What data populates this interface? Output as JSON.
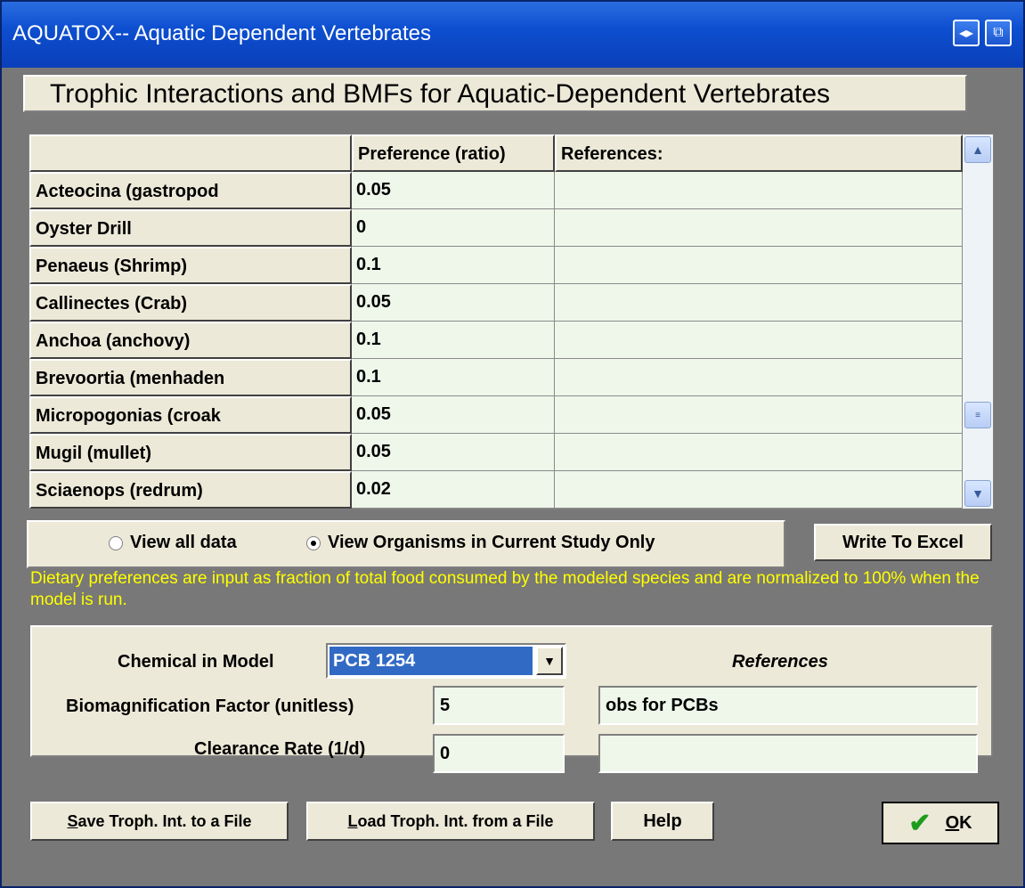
{
  "window": {
    "title": "AQUATOX-- Aquatic Dependent Vertebrates"
  },
  "header": {
    "title": "Trophic Interactions and BMFs for Aquatic-Dependent Vertebrates"
  },
  "grid": {
    "columns": [
      "",
      "Preference (ratio)",
      "References:"
    ],
    "rows": [
      {
        "name": "Acteocina (gastropod",
        "pref": "0.05",
        "ref": ""
      },
      {
        "name": "Oyster Drill",
        "pref": "0",
        "ref": ""
      },
      {
        "name": "Penaeus (Shrimp)",
        "pref": "0.1",
        "ref": ""
      },
      {
        "name": "Callinectes (Crab)",
        "pref": "0.05",
        "ref": ""
      },
      {
        "name": "Anchoa (anchovy)",
        "pref": "0.1",
        "ref": ""
      },
      {
        "name": "Brevoortia (menhaden",
        "pref": "0.1",
        "ref": ""
      },
      {
        "name": "Micropogonias (croak",
        "pref": "0.05",
        "ref": ""
      },
      {
        "name": "Mugil (mullet)",
        "pref": "0.05",
        "ref": ""
      },
      {
        "name": "Sciaenops (redrum)",
        "pref": "0.02",
        "ref": ""
      }
    ]
  },
  "view": {
    "options": [
      "View all data",
      "View Organisms in Current Study Only"
    ],
    "selected": "View Organisms in Current Study Only"
  },
  "buttons": {
    "write_excel": "Write To Excel",
    "save_prefix": "S",
    "save_rest": "ave Troph. Int. to a File",
    "load_prefix": "L",
    "load_rest": "oad Troph. Int. from a File",
    "help": "Help",
    "ok_prefix": "O",
    "ok_rest": "K"
  },
  "note": "Dietary preferences are input as fraction of total food consumed by the modeled species and are normalized to 100% when the model is run.",
  "chemical": {
    "label": "Chemical in Model",
    "selected": "PCB 1254",
    "references_header": "References",
    "bmf_label": "Biomagnification Factor (unitless)",
    "bmf_value": "5",
    "bmf_ref": "obs for PCBs",
    "clearance_label": "Clearance Rate (1/d)",
    "clearance_value": "0",
    "clearance_ref": ""
  },
  "colors": {
    "title_bar": "#0d4fd0",
    "panel": "#ece9d8",
    "grid_cell": "#eef7ea",
    "note_text": "#ffff00",
    "selection": "#316ac5"
  }
}
